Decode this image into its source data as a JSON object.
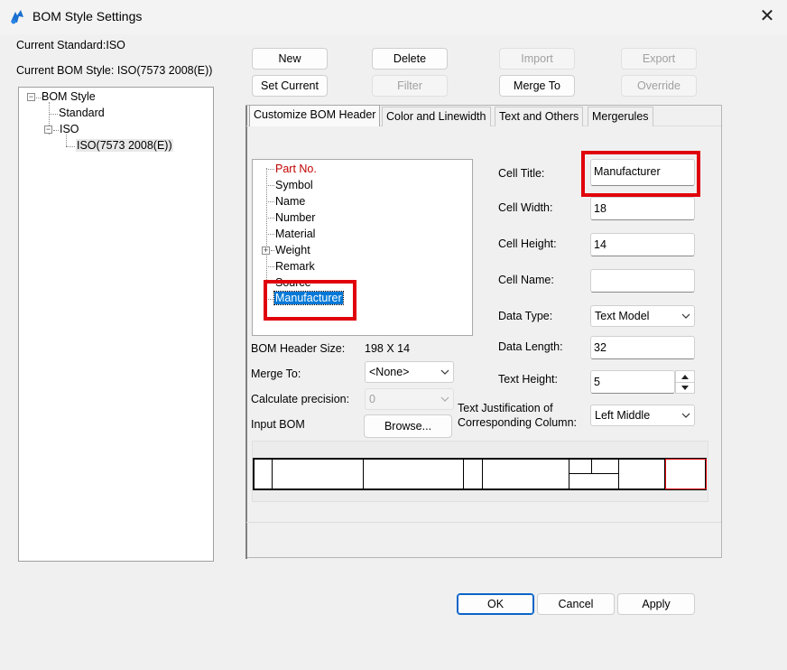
{
  "window": {
    "title": "BOM Style Settings"
  },
  "info": {
    "current_standard": "Current Standard:ISO",
    "current_bom_style": "Current BOM Style: ISO(7573 2008(E))"
  },
  "toolbar": {
    "new": "New",
    "delete": "Delete",
    "import": "Import",
    "export": "Export",
    "set_current": "Set Current",
    "filter": "Filter",
    "merge_to": "Merge To",
    "override": "Override"
  },
  "tree": {
    "root": "BOM Style",
    "standard": "Standard",
    "iso": "ISO",
    "iso_child": "ISO(7573 2008(E))"
  },
  "tabs": [
    "Customize BOM Header",
    "Color and Linewidth",
    "Text and Others",
    "Mergerules"
  ],
  "columns": [
    "Part No.",
    "Symbol",
    "Name",
    "Number",
    "Material",
    "Weight",
    "Remark",
    "Source",
    "Manufacturer"
  ],
  "left_fields": {
    "header_size_label": "BOM Header Size:",
    "header_size_value": "198 X 14",
    "merge_to_label": "Merge To:",
    "merge_to_value": "<None>",
    "calc_precision_label": "Calculate precision:",
    "calc_precision_value": "0",
    "input_bom_label": "Input BOM",
    "browse": "Browse..."
  },
  "right_fields": {
    "cell_title_label": "Cell Title:",
    "cell_title_value": "Manufacturer",
    "cell_width_label": "Cell Width:",
    "cell_width_value": "18",
    "cell_height_label": "Cell Height:",
    "cell_height_value": "14",
    "cell_name_label": "Cell Name:",
    "cell_name_value": "",
    "data_type_label": "Data Type:",
    "data_type_value": "Text Model",
    "data_length_label": "Data Length:",
    "data_length_value": "32",
    "text_height_label": "Text Height:",
    "text_height_value": "5",
    "text_just_label_1": "Text Justification of",
    "text_just_label_2": "Corresponding Column:",
    "text_just_value": "Left Middle"
  },
  "footer": {
    "ok": "OK",
    "cancel": "Cancel",
    "apply": "Apply"
  },
  "colors": {
    "highlight": "#e0000b",
    "selection": "#0078d7",
    "part_no": "#c00000"
  }
}
